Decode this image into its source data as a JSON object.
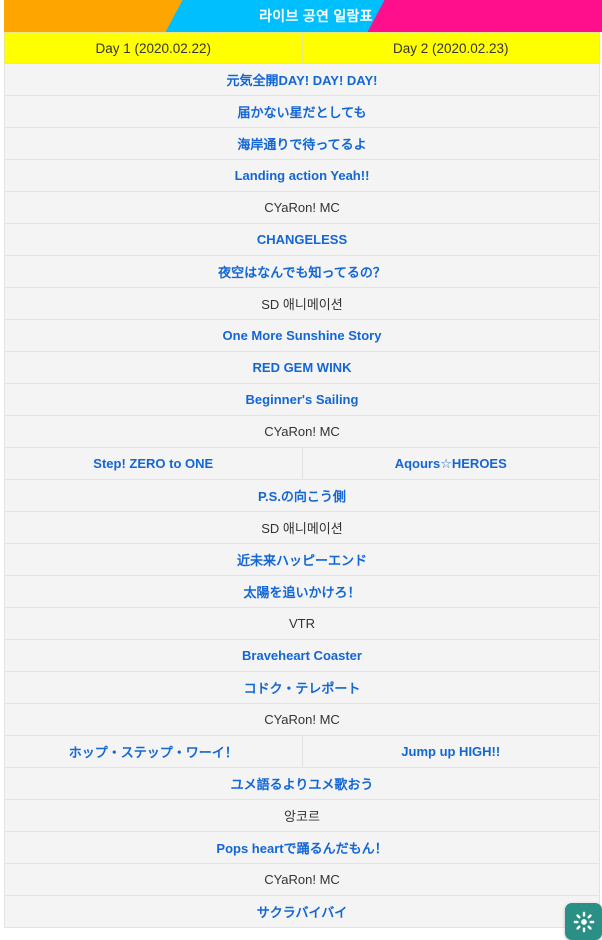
{
  "header": {
    "title": "라이브 공연 일람표",
    "colors": {
      "orange": "#ffa500",
      "cyan": "#00bfff",
      "magenta": "#ff0f8b",
      "title_text": "#ffffff"
    }
  },
  "day_header": {
    "day1": "Day 1 (2020.02.22)",
    "day2": "Day 2 (2020.02.23)",
    "background": "#ffff00"
  },
  "colors": {
    "song_text": "#1366d6",
    "plain_text": "#333333",
    "row_background": "#f4f4f4",
    "row_border": "#e3e3e3",
    "fab_background": "#2a9085"
  },
  "rows": [
    {
      "type": "full",
      "kind": "song",
      "text": "元気全開DAY! DAY! DAY!"
    },
    {
      "type": "full",
      "kind": "song",
      "text": "届かない星だとしても"
    },
    {
      "type": "full",
      "kind": "song",
      "text": "海岸通りで待ってるよ"
    },
    {
      "type": "full",
      "kind": "song",
      "text": "Landing action Yeah!!"
    },
    {
      "type": "full",
      "kind": "plain",
      "text": "CYaRon! MC"
    },
    {
      "type": "full",
      "kind": "song",
      "text": "CHANGELESS"
    },
    {
      "type": "full",
      "kind": "song",
      "text": "夜空はなんでも知ってるの？"
    },
    {
      "type": "full",
      "kind": "plain",
      "text": "SD 애니메이션"
    },
    {
      "type": "full",
      "kind": "song",
      "text": "One More Sunshine Story"
    },
    {
      "type": "full",
      "kind": "song",
      "text": "RED GEM WINK"
    },
    {
      "type": "full",
      "kind": "song",
      "text": "Beginner's Sailing"
    },
    {
      "type": "full",
      "kind": "plain",
      "text": "CYaRon! MC"
    },
    {
      "type": "split",
      "kind": "song",
      "left": "Step! ZERO to ONE",
      "right": "Aqours☆HEROES"
    },
    {
      "type": "full",
      "kind": "song",
      "text": "P.S.の向こう側"
    },
    {
      "type": "full",
      "kind": "plain",
      "text": "SD 애니메이션"
    },
    {
      "type": "full",
      "kind": "song",
      "text": "近未来ハッピーエンド"
    },
    {
      "type": "full",
      "kind": "song",
      "text": "太陽を追いかけろ！"
    },
    {
      "type": "full",
      "kind": "plain",
      "text": "VTR"
    },
    {
      "type": "full",
      "kind": "song",
      "text": "Braveheart Coaster"
    },
    {
      "type": "full",
      "kind": "song",
      "text": "コドク・テレポート"
    },
    {
      "type": "full",
      "kind": "plain",
      "text": "CYaRon! MC"
    },
    {
      "type": "split",
      "kind": "song",
      "left": "ホップ・ステップ・ワーイ！",
      "right": "Jump up HIGH!!"
    },
    {
      "type": "full",
      "kind": "song",
      "text": "ユメ語るよりユメ歌おう"
    },
    {
      "type": "full",
      "kind": "plain",
      "text": "앙코르"
    },
    {
      "type": "full",
      "kind": "song",
      "text": "Pops heartで踊るんだもん！"
    },
    {
      "type": "full",
      "kind": "plain",
      "text": "CYaRon! MC"
    },
    {
      "type": "full",
      "kind": "song",
      "text": "サクラバイバイ"
    }
  ],
  "fab": {
    "icon": "gear-icon"
  }
}
